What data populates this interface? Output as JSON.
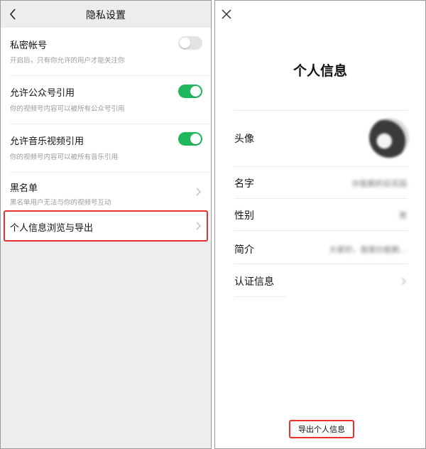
{
  "left_screen": {
    "nav": {
      "title": "隐私设置"
    },
    "items": [
      {
        "label": "私密帐号",
        "subtitle": "开启后，只有你允许的用户才能关注你",
        "control": "toggle",
        "enabled": false
      },
      {
        "label": "允许公众号引用",
        "subtitle": "你的视频号内容可以被所有公众号引用",
        "control": "toggle",
        "enabled": true
      },
      {
        "label": "允许音乐视频引用",
        "subtitle": "你的视频号内容可以被所有音乐引用",
        "control": "toggle",
        "enabled": true
      },
      {
        "label": "黑名单",
        "subtitle": "黑名单用户无法与你的视频号互动",
        "control": "chevron"
      },
      {
        "label": "个人信息浏览与导出",
        "subtitle": "",
        "control": "chevron",
        "highlighted": true
      }
    ]
  },
  "right_screen": {
    "title": "个人信息",
    "fields": [
      {
        "label": "头像",
        "value": ""
      },
      {
        "label": "名字",
        "value": "炒能鹅的后花园"
      },
      {
        "label": "性别",
        "value": "男"
      },
      {
        "label": "简介",
        "value": "大家好，我是炒能鹅..."
      },
      {
        "label": "认证信息",
        "value": ""
      }
    ],
    "export_button": "导出个人信息"
  },
  "colors": {
    "toggle_on": "#1fb75c",
    "toggle_off": "#e3e3e3",
    "highlight": "#e8302f",
    "screen_bg": "#ededed"
  }
}
